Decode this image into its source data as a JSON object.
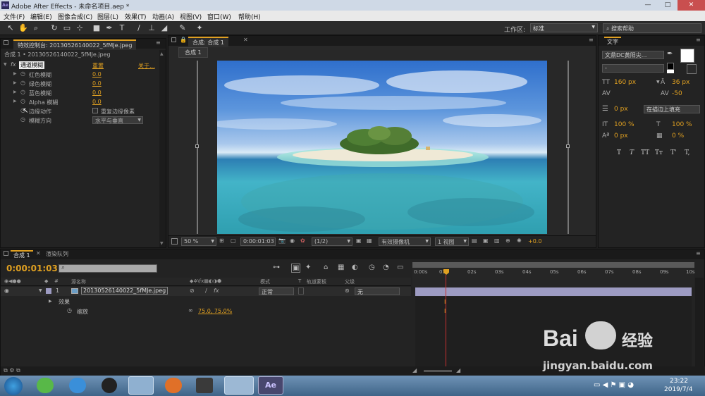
{
  "window": {
    "app_title": "Adobe After Effects - 未命名项目.aep *",
    "logo": "Ae",
    "minimize": "—",
    "maximize": "□",
    "close": "✕"
  },
  "menu": [
    "文件(F)",
    "编辑(E)",
    "图像合成(C)",
    "图层(L)",
    "效果(T)",
    "动画(A)",
    "视图(V)",
    "窗口(W)",
    "帮助(H)"
  ],
  "toolbar": {
    "workspace_label": "工作区:",
    "workspace_value": "标准",
    "search_placeholder": "搜索帮助"
  },
  "effects_panel": {
    "tab_label": "特效控制台: 20130526140022_5fMJe.jpeg",
    "breadcrumb": "合成 1 • 20130526140022_5fMJe.jpeg",
    "effect_name": "通道模糊",
    "reset": "重置",
    "about": "关于...",
    "params": [
      {
        "name": "红色模糊",
        "value": "0.0"
      },
      {
        "name": "绿色模糊",
        "value": "0.0"
      },
      {
        "name": "蓝色模糊",
        "value": "0.0"
      },
      {
        "name": "Alpha 模糊",
        "value": "0.0"
      }
    ],
    "edge_label": "边缘动作",
    "edge_checkbox": "重复边缘像素",
    "dir_label": "模糊方向",
    "dir_value": "水平与垂直"
  },
  "comp_panel": {
    "tab_label": "合成: 合成 1",
    "subtab": "合成 1",
    "zoom": "50 %",
    "timecode": "0:00:01:03",
    "resolution": "(1/2)",
    "camera": "有效摄像机",
    "views": "1 视图",
    "exposure": "+0.0"
  },
  "text_panel": {
    "title": "文字",
    "font_family": "文鼎DC黄阳尖...",
    "font_style": "-",
    "size": "160 px",
    "leading": "36 px",
    "kerning": "",
    "tracking": "-50",
    "stroke_width": "0 px",
    "stroke_mode": "在描边上填充",
    "vscale": "100 %",
    "hscale": "100 %",
    "baseline": "0 px",
    "tsume": "0 %",
    "styles": [
      "T",
      "T",
      "TT",
      "Tт",
      "T'",
      "T,"
    ]
  },
  "timeline": {
    "tab_comp": "合成 1",
    "tab_render": "渲染队列",
    "timecode": "0:00:01:03",
    "col_source": "源名称",
    "col_mode": "模式",
    "col_t": "T",
    "col_trkmat": "轨道蒙板",
    "col_parent": "父级",
    "layer": {
      "index": "1",
      "name": "20130526140022_5fMJe.jpeg",
      "mode": "正常",
      "parent": "无"
    },
    "effects_label": "效果",
    "scale_label": "缩放",
    "scale_value": "75.0, 75.0%",
    "ruler": [
      "0:00s",
      "01s",
      "02s",
      "03s",
      "04s",
      "05s",
      "06s",
      "07s",
      "08s",
      "09s",
      "10s"
    ]
  },
  "taskbar": {
    "time": "23:22",
    "date": "2019/7/4"
  },
  "watermark": {
    "brand": "Bai",
    "brand2": "经验",
    "url": "jingyan.baidu.com"
  },
  "colors": {
    "accent": "#e0a021",
    "layer_bar": "#9d9bc2",
    "playhead": "#c83030"
  }
}
